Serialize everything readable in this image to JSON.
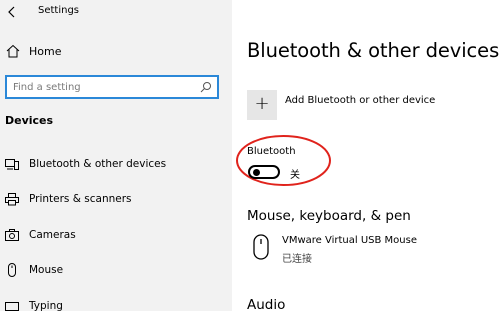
{
  "window": {
    "title": "Settings"
  },
  "sidebar": {
    "home_label": "Home",
    "search_placeholder": "Find a setting",
    "section_title": "Devices",
    "items": [
      {
        "label": "Bluetooth & other devices",
        "icon": "bluetooth-devices-icon"
      },
      {
        "label": "Printers & scanners",
        "icon": "printer-icon"
      },
      {
        "label": "Cameras",
        "icon": "camera-icon"
      },
      {
        "label": "Mouse",
        "icon": "mouse-icon"
      },
      {
        "label": "Typing",
        "icon": "keyboard-icon"
      }
    ]
  },
  "main": {
    "title": "Bluetooth & other devices",
    "add_device_label": "Add Bluetooth or other device",
    "bluetooth": {
      "label": "Bluetooth",
      "state": "关",
      "on": false
    },
    "section_mouse_keyboard": "Mouse, keyboard, & pen",
    "device": {
      "name": "VMware Virtual USB Mouse",
      "status": "已连接"
    },
    "section_audio": "Audio"
  },
  "annotation": {
    "color": "#e0231c"
  },
  "colors": {
    "accent": "#2b88d8",
    "sidebar_bg": "#f2f2f2"
  }
}
